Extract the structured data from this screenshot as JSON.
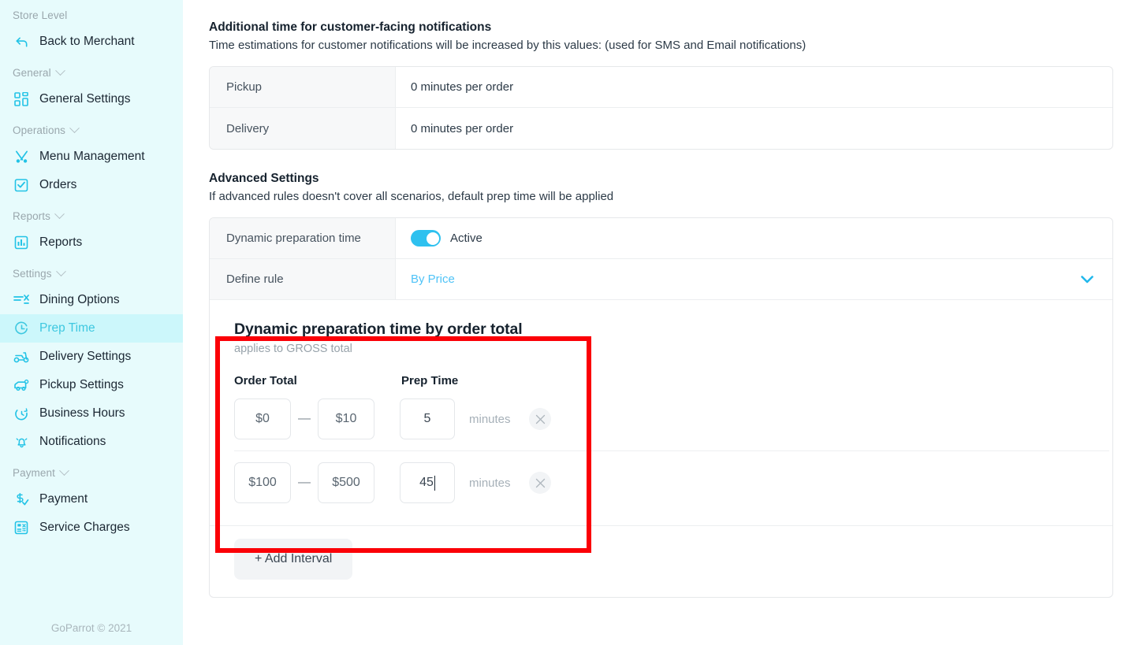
{
  "sidebar": {
    "groups": [
      {
        "label": "Store Level",
        "has_caret": false,
        "items": [
          {
            "label": "Back to Merchant",
            "icon": "back-arrow-icon",
            "active": false
          }
        ]
      },
      {
        "label": "General",
        "has_caret": true,
        "items": [
          {
            "label": "General Settings",
            "icon": "grid-blocks-icon",
            "active": false
          }
        ]
      },
      {
        "label": "Operations",
        "has_caret": true,
        "items": [
          {
            "label": "Menu Management",
            "icon": "fork-knife-icon",
            "active": false
          },
          {
            "label": "Orders",
            "icon": "clipboard-check-icon",
            "active": false
          }
        ]
      },
      {
        "label": "Reports",
        "has_caret": true,
        "items": [
          {
            "label": "Reports",
            "icon": "bar-chart-icon",
            "active": false
          }
        ]
      },
      {
        "label": "Settings",
        "has_caret": true,
        "items": [
          {
            "label": "Dining Options",
            "icon": "sliders-icon",
            "active": false
          },
          {
            "label": "Prep Time",
            "icon": "clock-icon",
            "active": true
          },
          {
            "label": "Delivery Settings",
            "icon": "scooter-icon",
            "active": false
          },
          {
            "label": "Pickup Settings",
            "icon": "car-pickup-icon",
            "active": false
          },
          {
            "label": "Business Hours",
            "icon": "stopwatch-icon",
            "active": false
          },
          {
            "label": "Notifications",
            "icon": "bell-icon",
            "active": false
          }
        ]
      },
      {
        "label": "Payment",
        "has_caret": true,
        "items": [
          {
            "label": "Payment",
            "icon": "dollar-check-icon",
            "active": false
          },
          {
            "label": "Service Charges",
            "icon": "receipt-calculator-icon",
            "active": false
          }
        ]
      }
    ],
    "footer": "GoParrot © 2021"
  },
  "main": {
    "notifications_section": {
      "title": "Additional time for customer-facing notifications",
      "subtitle": "Time estimations for customer notifications will be increased by this values: (used for SMS and Email notifications)",
      "rows": [
        {
          "label": "Pickup",
          "value": "0 minutes per order"
        },
        {
          "label": "Delivery",
          "value": "0 minutes per order"
        }
      ]
    },
    "advanced_section": {
      "title": "Advanced Settings",
      "subtitle": "If advanced rules doesn't cover all scenarios, default prep time will be applied",
      "dynamic_prep": {
        "label": "Dynamic preparation time",
        "toggle_state": "on",
        "toggle_text": "Active"
      },
      "define_rule": {
        "label": "Define rule",
        "selected": "By Price"
      },
      "rule_editor": {
        "title": "Dynamic preparation time by order total",
        "subtitle": "applies to GROSS total",
        "col_order_total": "Order Total",
        "col_prep_time": "Prep Time",
        "dash": "—",
        "minutes_label": "minutes",
        "intervals": [
          {
            "from": "$0",
            "to": "$10",
            "prep": "5",
            "focused": false
          },
          {
            "from": "$100",
            "to": "$500",
            "prep": "45",
            "focused": true
          }
        ]
      },
      "add_interval_label": "+ Add Interval"
    }
  },
  "colors": {
    "accent_cyan": "#22c3e6",
    "toggle_on": "#2ec1ef",
    "link_blue": "#4fc3f7",
    "highlight_red": "#fb0007",
    "sidebar_bg": "#e7fbfc",
    "sidebar_active_bg": "#ccf7fb"
  }
}
